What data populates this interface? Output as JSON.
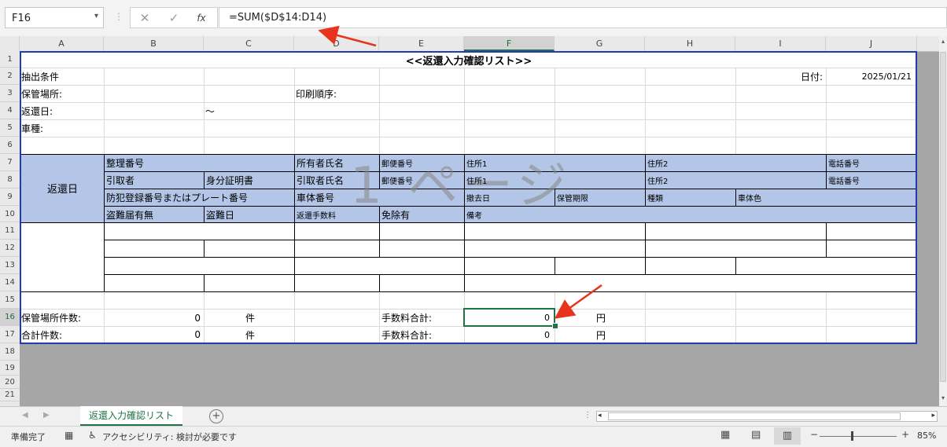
{
  "formula_bar": {
    "name_box": "F16",
    "cancel_icon": "✕",
    "enter_icon": "✓",
    "fx_label": "fx",
    "formula": "=SUM($D$14:D14)"
  },
  "columns": [
    "A",
    "B",
    "C",
    "D",
    "E",
    "F",
    "G",
    "H",
    "I",
    "J"
  ],
  "rows": [
    "1",
    "2",
    "3",
    "4",
    "5",
    "6",
    "7",
    "8",
    "9",
    "10",
    "11",
    "12",
    "13",
    "14",
    "15",
    "16",
    "17",
    "18",
    "19",
    "20",
    "21"
  ],
  "sheet": {
    "title": "<<返還入力確認リスト>>",
    "r2": {
      "label": "抽出条件",
      "date_label": "日付:",
      "date": "2025/01/21"
    },
    "r3": {
      "storage": "保管場所:",
      "print_order": "印刷順序:"
    },
    "r4": {
      "return_date": "返還日:",
      "tilde": "～"
    },
    "r5": {
      "vehicle_type": "車種:"
    },
    "header": {
      "return_day": "返還日",
      "r7": [
        "整理番号",
        "所有者氏名",
        "郵便番号",
        "住所1",
        "住所2",
        "電話番号"
      ],
      "r8": [
        "引取者",
        "身分証明書",
        "引取者氏名",
        "郵便番号",
        "住所1",
        "住所2",
        "電話番号"
      ],
      "r9": [
        "防犯登録番号またはプレート番号",
        "車体番号",
        "撤去日",
        "保管期限",
        "種類",
        "車体色"
      ],
      "r10": [
        "盗難届有無",
        "盗難日",
        "返還手数料",
        "免除有",
        "備考"
      ]
    },
    "watermark": "1 ページ",
    "r16": {
      "label": "保管場所件数:",
      "count": "0",
      "unit": "件",
      "fee_label": "手数料合計:",
      "fee": "0",
      "yen": "円"
    },
    "r17": {
      "label": "合計件数:",
      "count": "0",
      "unit": "件",
      "fee_label": "手数料合計:",
      "fee": "0",
      "yen": "円"
    }
  },
  "tabs": {
    "sheet_name": "返還入力確認リスト",
    "add": "+"
  },
  "status": {
    "ready": "準備完了",
    "accessibility": "アクセシビリティ: 検討が必要です",
    "zoom": "85%"
  },
  "colors": {
    "header_blue": "#b4c6e7",
    "excel_green": "#217346",
    "arrow_red": "#e8341c"
  }
}
